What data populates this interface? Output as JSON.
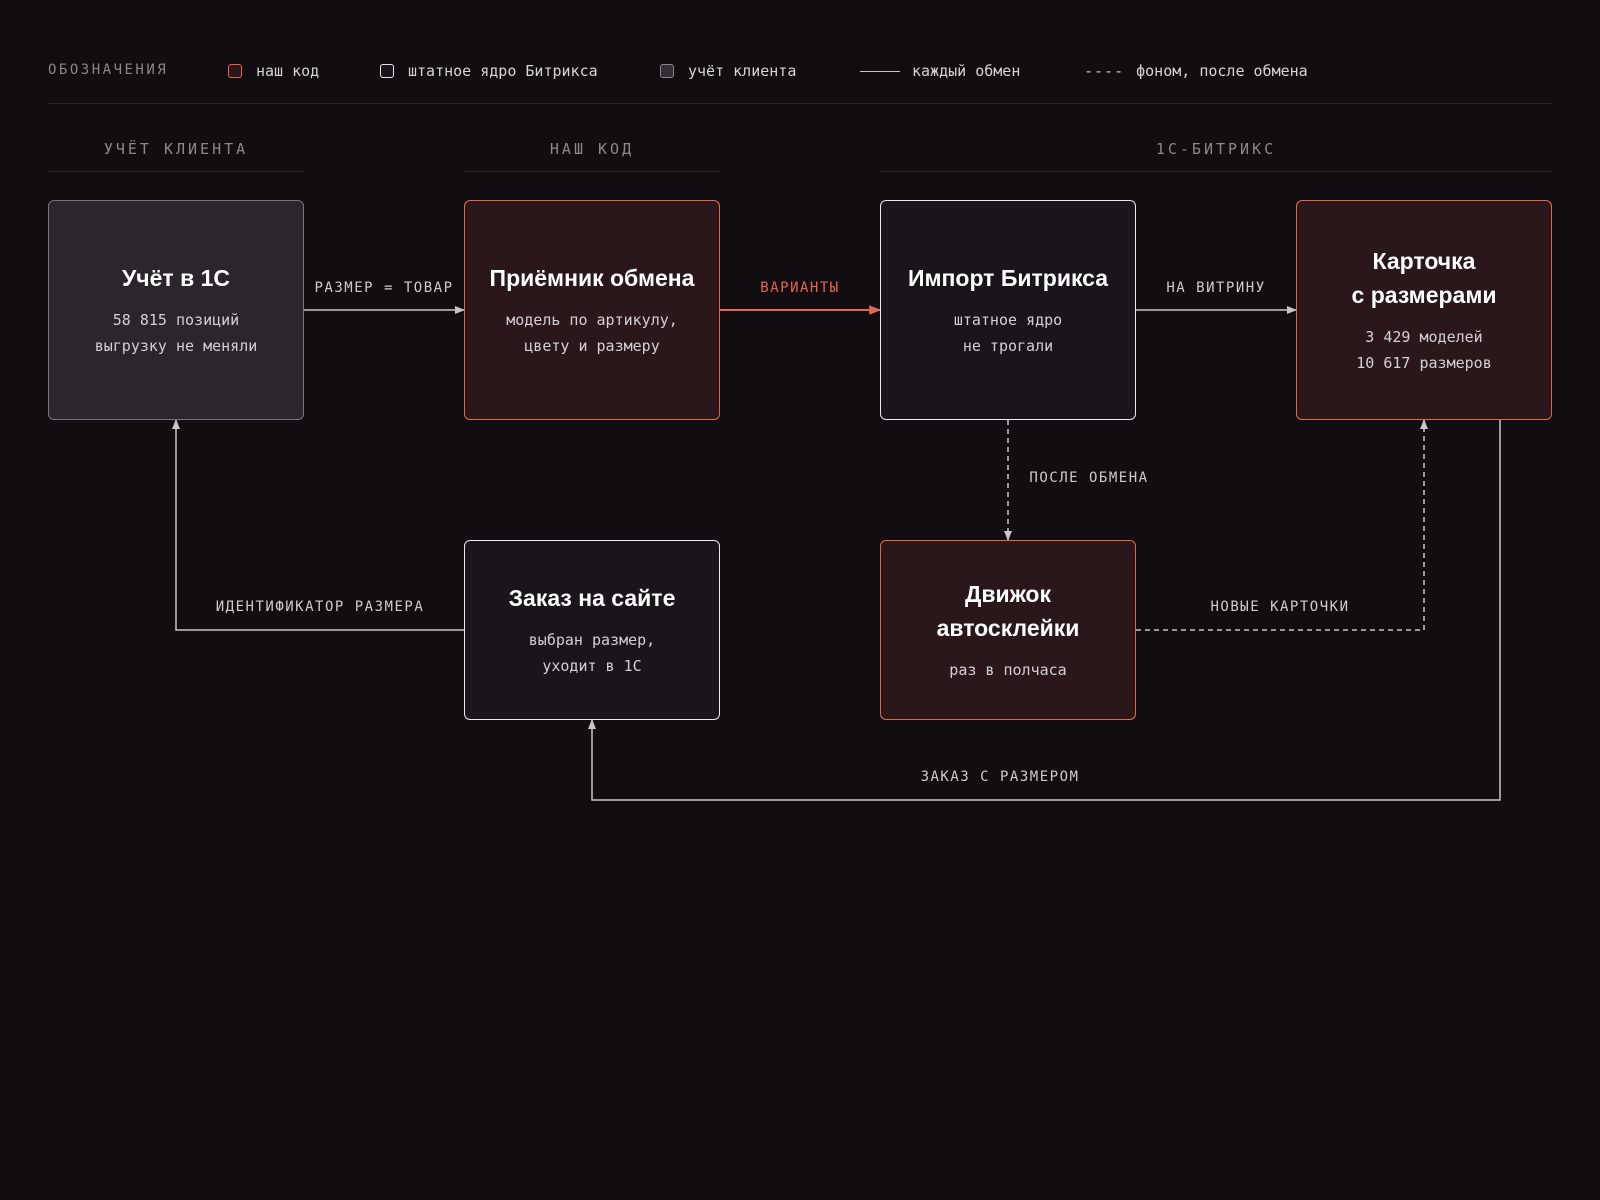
{
  "legend": {
    "title": "ОБОЗНАЧЕНИЯ",
    "our_code": "наш код",
    "core": "штатное ядро Битрикса",
    "client": "учёт клиента",
    "solid_dash": "",
    "solid": "каждый обмен",
    "dashed_mark": "----",
    "dashed": "фоном, после обмена"
  },
  "columns": {
    "client": "УЧЁТ КЛИЕНТА",
    "ours": "НАШ КОД",
    "bitrix": "1С-БИТРИКС"
  },
  "nodes": {
    "account": {
      "title": "Учёт в 1С",
      "sub1": "58 815 позиций",
      "sub2": "выгрузку не меняли"
    },
    "receiver": {
      "title": "Приёмник обмена",
      "sub1": "модель по артикулу,",
      "sub2": "цвету и размеру"
    },
    "import": {
      "title": "Импорт Битрикса",
      "sub1": "штатное ядро",
      "sub2": "не трогали"
    },
    "card": {
      "title1": "Карточка",
      "title2": "с размерами",
      "sub1": "3 429 моделей",
      "sub2": "10 617 размеров"
    },
    "order": {
      "title": "Заказ на сайте",
      "sub1": "выбран размер,",
      "sub2": "уходит в 1С"
    },
    "engine": {
      "title1": "Движок",
      "title2": "автосклейки",
      "sub1": "раз в полчаса"
    }
  },
  "edges": {
    "size_is_product": "РАЗМЕР = ТОВАР",
    "variants": "ВАРИАНТЫ",
    "to_showcase": "НА ВИТРИНУ",
    "after_exchange": "ПОСЛЕ ОБМЕНА",
    "new_cards": "НОВЫЕ КАРТОЧКИ",
    "size_id": "ИДЕНТИФИКАТОР РАЗМЕРА",
    "order_with_size": "ЗАКАЗ С РАЗМЕРОМ"
  },
  "colors": {
    "background": "#110d10",
    "accent": "#e5664f",
    "edge": "#c9c5c9"
  }
}
